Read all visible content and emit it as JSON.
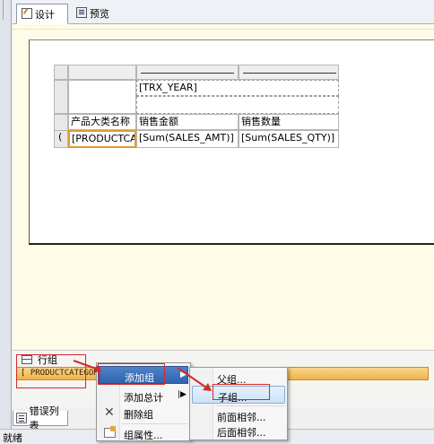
{
  "tabs": [
    {
      "label": "设计",
      "icon": "design-icon",
      "active": true
    },
    {
      "label": "预览",
      "icon": "preview-icon",
      "active": false
    }
  ],
  "report": {
    "column_group_field": "[TRX_YEAR]",
    "header_row": {
      "c1": "产品大类名称",
      "c2": "销售金额",
      "c3": "销售数量"
    },
    "detail_row": {
      "handle": "(",
      "c1": "[PRODUCTCA",
      "c2": "[Sum(SALES_AMT)]",
      "c3": "[Sum(SALES_QTY)]"
    }
  },
  "group_panel": {
    "title": "行组",
    "field": "[ PRODUCTCATEGORY_"
  },
  "context_menu": {
    "items": [
      {
        "label": "添加组",
        "has_submenu": true
      },
      {
        "label": "添加总计",
        "has_submenu": true
      },
      {
        "label": "删除组",
        "icon": "delete-icon"
      },
      {
        "label": "组属性...",
        "icon": "properties-icon"
      }
    ]
  },
  "submenu": {
    "items": [
      {
        "label": "父组..."
      },
      {
        "label": "子组..."
      },
      {
        "label": "前面相邻..."
      },
      {
        "label": "后面相邻..."
      }
    ]
  },
  "bottom_tab": {
    "label": "错误列表",
    "icon": "error-list-icon"
  },
  "status_bar": {
    "text": "就绪"
  },
  "colors": {
    "canvas_bg": "#fefce6",
    "group_field_bg": "#f0b44b",
    "highlight_red": "#d42a2a",
    "selection_blue": "#cfe2f7"
  }
}
